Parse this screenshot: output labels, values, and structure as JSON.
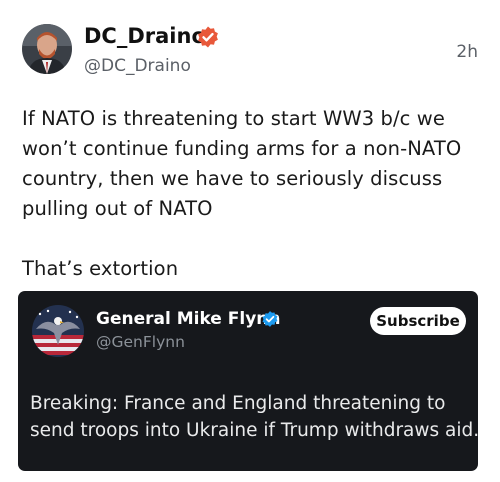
{
  "post": {
    "author": {
      "display_name": "DC_Draino",
      "handle": "@DC_Draino",
      "verified_icon": "verified-badge-orange-icon",
      "avatar_icon": "profile-photo-avatar"
    },
    "timestamp": "2h",
    "body_lines": [
      "If NATO is threatening to start WW3 b/c we",
      "won’t continue funding arms for a non-NATO",
      "country, then we have to seriously discuss",
      "pulling out of NATO"
    ],
    "body_closing": "That’s extortion"
  },
  "quoted_post": {
    "author": {
      "display_name": "General Mike Flynn",
      "handle": "@GenFlynn",
      "verified_icon": "verified-badge-blue-icon",
      "avatar_icon": "eagle-flag-avatar"
    },
    "subscribe_label": "Subscribe",
    "text_lines": [
      "Breaking: France and England threatening to",
      "send troops into Ukraine if Trump withdraws aid."
    ]
  },
  "colors": {
    "page_background": "#ffffff",
    "card_background": "#16181c",
    "verified_orange": "#e8583a",
    "verified_blue": "#1d9bf0",
    "muted_text": "#5b6067"
  }
}
